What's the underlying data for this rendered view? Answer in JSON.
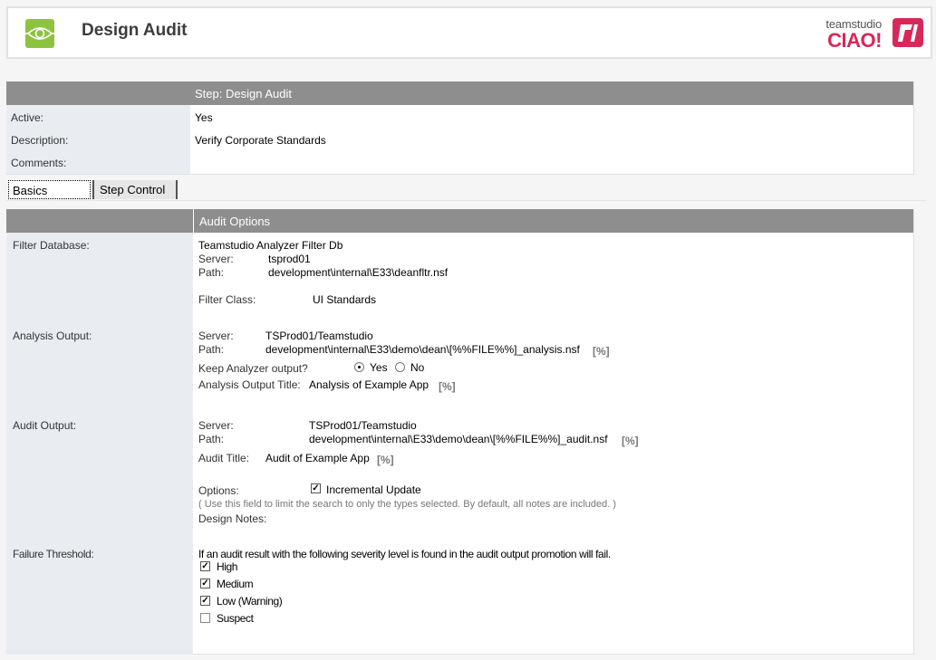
{
  "header": {
    "title": "Design Audit",
    "app_icon": "eye-icon",
    "logo": {
      "small_text": "teamstudio",
      "big_text": "CIAO!",
      "mark_icon": "teamstudio-logo-icon",
      "brand_color": "#d8285a"
    },
    "icon_color": "#8dc33f"
  },
  "step": {
    "header": "Step:  Design Audit",
    "fields": [
      {
        "label": "Active:",
        "value": "Yes"
      },
      {
        "label": "Description:",
        "value": "Verify Corporate Standards"
      },
      {
        "label": "Comments:",
        "value": ""
      }
    ]
  },
  "tabs": [
    {
      "label": "Basics",
      "active": true
    },
    {
      "label": "Step Control",
      "active": false
    }
  ],
  "audit_options": {
    "header": "Audit Options",
    "filter_database": {
      "label": "Filter Database:",
      "name": "Teamstudio Analyzer Filter Db",
      "server_label": "Server:",
      "server": "tsprod01",
      "path_label": "Path:",
      "path": "development\\internal\\E33\\deanfltr.nsf",
      "class_label": "Filter Class:",
      "class": "UI Standards"
    },
    "analysis_output": {
      "label": "Analysis Output:",
      "server_label": "Server:",
      "server": "TSProd01/Teamstudio",
      "path_label": "Path:",
      "path": "development\\internal\\E33\\demo\\dean\\[%%FILE%%]_analysis.nsf",
      "formula_marker": "[%]",
      "keep_label": "Keep Analyzer output?",
      "keep_options": [
        "Yes",
        "No"
      ],
      "keep_selected": "Yes",
      "title_label": "Analysis Output Title:",
      "title": "Analysis of  Example App"
    },
    "audit_output": {
      "label": "Audit Output:",
      "server_label": "Server:",
      "server": "TSProd01/Teamstudio",
      "path_label": "Path:",
      "path": "development\\internal\\E33\\demo\\dean\\[%%FILE%%]_audit.nsf",
      "formula_marker": "[%]",
      "title_label": "Audit Title:",
      "title": "Audit of Example App",
      "options_label": "Options:",
      "option": "Incremental Update",
      "option_checked": true,
      "hint": "( Use this field to limit the search to only the types selected. By default, all notes are included. )",
      "design_notes_label": "Design Notes:"
    },
    "failure_threshold": {
      "label": "Failure Threshold:",
      "description": "If an audit result with the following severity level is found in the audit output promotion will fail.",
      "levels": [
        {
          "label": "High",
          "checked": true
        },
        {
          "label": "Medium",
          "checked": true
        },
        {
          "label": "Low (Warning)",
          "checked": true
        },
        {
          "label": "Suspect",
          "checked": false
        }
      ]
    }
  }
}
